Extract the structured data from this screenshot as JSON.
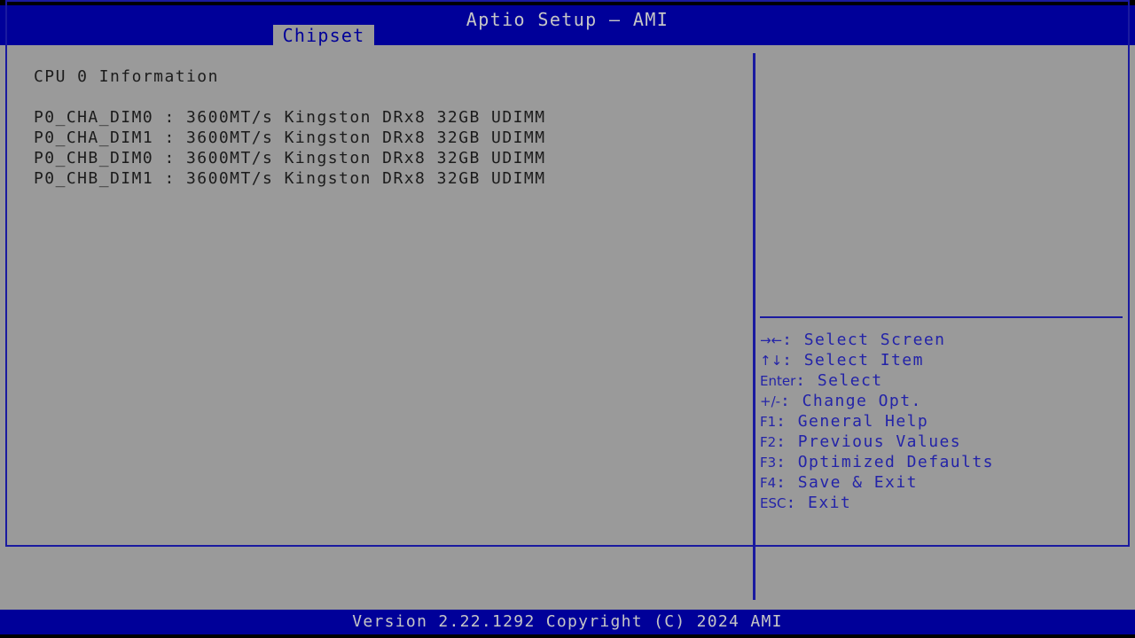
{
  "header": {
    "title": "Aptio Setup – AMI",
    "bg_color": "#000099",
    "text_color": "#c6c6c6"
  },
  "menu": {
    "tabs": [
      {
        "label": "Chipset",
        "active": true
      }
    ],
    "active_tab_bg": "#9a9a9a",
    "active_tab_text": "#000099"
  },
  "left_pane": {
    "heading": "CPU 0 Information",
    "dimm_rows": [
      "P0_CHA_DIM0 : 3600MT/s Kingston DRx8 32GB UDIMM",
      "P0_CHA_DIM1 : 3600MT/s Kingston DRx8 32GB UDIMM",
      "P0_CHB_DIM0 : 3600MT/s Kingston DRx8 32GB UDIMM",
      "P0_CHB_DIM1 : 3600MT/s Kingston DRx8 32GB UDIMM"
    ],
    "text_color": "#1c1c1c"
  },
  "right_pane": {
    "help_items": [
      {
        "keys": "→←",
        "label": ": Select Screen"
      },
      {
        "keys": "↑↓",
        "label": ": Select Item"
      },
      {
        "keys": "Enter",
        "label": ": Select"
      },
      {
        "keys": "+/-",
        "label": ": Change Opt."
      },
      {
        "keys": "F1",
        "label": ": General Help"
      },
      {
        "keys": "F2",
        "label": ": Previous Values"
      },
      {
        "keys": "F3",
        "label": ": Optimized Defaults"
      },
      {
        "keys": "F4",
        "label": ": Save & Exit"
      },
      {
        "keys": "ESC",
        "label": ": Exit"
      }
    ],
    "text_color": "#2323a8"
  },
  "footer": {
    "text": "Version 2.22.1292 Copyright (C) 2024 AMI",
    "bg_color": "#000099",
    "text_color": "#c6c6c6"
  },
  "theme": {
    "panel_bg": "#9a9a9a",
    "frame_color": "#1a1aa0",
    "screen_bg": "#000000"
  }
}
